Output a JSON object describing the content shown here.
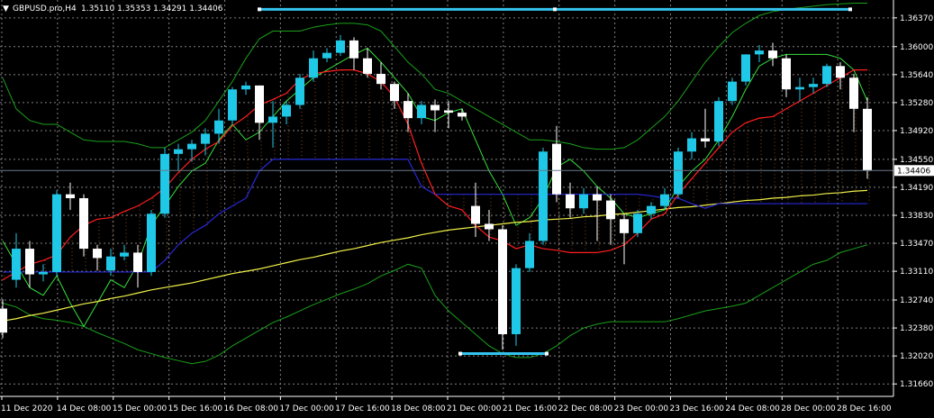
{
  "header": {
    "symbol": "GBPUSD.pro,H4",
    "ohlc": "1.35110 1.35353 1.34291 1.34406"
  },
  "colors": {
    "background": "#000000",
    "grid": "#808080",
    "bull": "#1fc8e6",
    "bear": "#ffffff",
    "fast_ma": "#ff1e1e",
    "slow_ma": "#2828d8",
    "long_ma": "#f0f04a",
    "envelope": "#1aa01a",
    "fast_band": "#36e03a",
    "cloud": "#f08c3c",
    "hline": "#33c2ee"
  },
  "chart_data": {
    "type": "candlestick",
    "y_axis": {
      "ylim": [
        1.315,
        1.366
      ],
      "ticks": [
        "1.36370",
        "1.36000",
        "1.35640",
        "1.35280",
        "1.34920",
        "1.34550",
        "1.34190",
        "1.33830",
        "1.33470",
        "1.33110",
        "1.32740",
        "1.32380",
        "1.32020",
        "1.31660"
      ],
      "current_price": "1.34406"
    },
    "x_axis": {
      "ticks": [
        "11 Dec 2020",
        "14 Dec 08:00",
        "15 Dec 00:00",
        "15 Dec 16:00",
        "16 Dec 08:00",
        "17 Dec 00:00",
        "17 Dec 16:00",
        "18 Dec 08:00",
        "21 Dec 00:00",
        "21 Dec 16:00",
        "22 Dec 08:00",
        "23 Dec 00:00",
        "23 Dec 16:00",
        "24 Dec 08:00",
        "28 Dec 00:00",
        "28 Dec 16:00"
      ]
    },
    "grid": true,
    "candles": [
      {
        "o": 1.3263,
        "h": 1.3275,
        "l": 1.3225,
        "c": 1.3232
      },
      {
        "o": 1.33,
        "h": 1.336,
        "l": 1.329,
        "c": 1.334
      },
      {
        "o": 1.334,
        "h": 1.335,
        "l": 1.329,
        "c": 1.3307
      },
      {
        "o": 1.3307,
        "h": 1.332,
        "l": 1.3298,
        "c": 1.331
      },
      {
        "o": 1.331,
        "h": 1.3415,
        "l": 1.3305,
        "c": 1.341
      },
      {
        "o": 1.341,
        "h": 1.3425,
        "l": 1.339,
        "c": 1.3405
      },
      {
        "o": 1.3405,
        "h": 1.341,
        "l": 1.333,
        "c": 1.334
      },
      {
        "o": 1.334,
        "h": 1.3345,
        "l": 1.3312,
        "c": 1.3328
      },
      {
        "o": 1.3312,
        "h": 1.334,
        "l": 1.3305,
        "c": 1.333
      },
      {
        "o": 1.333,
        "h": 1.3345,
        "l": 1.3325,
        "c": 1.3335
      },
      {
        "o": 1.3335,
        "h": 1.3345,
        "l": 1.329,
        "c": 1.331
      },
      {
        "o": 1.331,
        "h": 1.339,
        "l": 1.3305,
        "c": 1.3385
      },
      {
        "o": 1.3385,
        "h": 1.347,
        "l": 1.338,
        "c": 1.3462
      },
      {
        "o": 1.3462,
        "h": 1.3475,
        "l": 1.344,
        "c": 1.3468
      },
      {
        "o": 1.3468,
        "h": 1.348,
        "l": 1.3452,
        "c": 1.3475
      },
      {
        "o": 1.3475,
        "h": 1.3495,
        "l": 1.346,
        "c": 1.3488
      },
      {
        "o": 1.3488,
        "h": 1.352,
        "l": 1.3475,
        "c": 1.3505
      },
      {
        "o": 1.3505,
        "h": 1.3548,
        "l": 1.35,
        "c": 1.3545
      },
      {
        "o": 1.3545,
        "h": 1.3555,
        "l": 1.3538,
        "c": 1.355
      },
      {
        "o": 1.355,
        "h": 1.355,
        "l": 1.348,
        "c": 1.3502
      },
      {
        "o": 1.3502,
        "h": 1.353,
        "l": 1.347,
        "c": 1.351
      },
      {
        "o": 1.351,
        "h": 1.353,
        "l": 1.35,
        "c": 1.3525
      },
      {
        "o": 1.3525,
        "h": 1.3565,
        "l": 1.352,
        "c": 1.356
      },
      {
        "o": 1.356,
        "h": 1.3595,
        "l": 1.3555,
        "c": 1.3585
      },
      {
        "o": 1.3585,
        "h": 1.3598,
        "l": 1.358,
        "c": 1.3592
      },
      {
        "o": 1.3592,
        "h": 1.3615,
        "l": 1.3588,
        "c": 1.3608
      },
      {
        "o": 1.3608,
        "h": 1.3612,
        "l": 1.357,
        "c": 1.3585
      },
      {
        "o": 1.3585,
        "h": 1.3598,
        "l": 1.356,
        "c": 1.3565
      },
      {
        "o": 1.3565,
        "h": 1.358,
        "l": 1.3545,
        "c": 1.3552
      },
      {
        "o": 1.3552,
        "h": 1.3555,
        "l": 1.352,
        "c": 1.353
      },
      {
        "o": 1.353,
        "h": 1.354,
        "l": 1.349,
        "c": 1.3508
      },
      {
        "o": 1.3508,
        "h": 1.353,
        "l": 1.35,
        "c": 1.3525
      },
      {
        "o": 1.3525,
        "h": 1.3532,
        "l": 1.349,
        "c": 1.3518
      },
      {
        "o": 1.3518,
        "h": 1.353,
        "l": 1.3495,
        "c": 1.3515
      },
      {
        "o": 1.3515,
        "h": 1.352,
        "l": 1.3505,
        "c": 1.351
      },
      {
        "o": 1.3395,
        "h": 1.3425,
        "l": 1.3355,
        "c": 1.3372
      },
      {
        "o": 1.3372,
        "h": 1.339,
        "l": 1.335,
        "c": 1.3365
      },
      {
        "o": 1.3365,
        "h": 1.337,
        "l": 1.321,
        "c": 1.323
      },
      {
        "o": 1.323,
        "h": 1.332,
        "l": 1.3215,
        "c": 1.3315
      },
      {
        "o": 1.3315,
        "h": 1.336,
        "l": 1.331,
        "c": 1.335
      },
      {
        "o": 1.335,
        "h": 1.347,
        "l": 1.3345,
        "c": 1.3465
      },
      {
        "o": 1.3475,
        "h": 1.3498,
        "l": 1.34,
        "c": 1.341
      },
      {
        "o": 1.341,
        "h": 1.3425,
        "l": 1.338,
        "c": 1.3392
      },
      {
        "o": 1.3392,
        "h": 1.3418,
        "l": 1.3385,
        "c": 1.341
      },
      {
        "o": 1.341,
        "h": 1.342,
        "l": 1.335,
        "c": 1.3402
      },
      {
        "o": 1.3402,
        "h": 1.341,
        "l": 1.3345,
        "c": 1.3378
      },
      {
        "o": 1.3378,
        "h": 1.3385,
        "l": 1.332,
        "c": 1.336
      },
      {
        "o": 1.336,
        "h": 1.339,
        "l": 1.3355,
        "c": 1.3385
      },
      {
        "o": 1.3385,
        "h": 1.34,
        "l": 1.3378,
        "c": 1.3395
      },
      {
        "o": 1.3395,
        "h": 1.3418,
        "l": 1.339,
        "c": 1.341
      },
      {
        "o": 1.341,
        "h": 1.347,
        "l": 1.3405,
        "c": 1.3465
      },
      {
        "o": 1.3465,
        "h": 1.349,
        "l": 1.3455,
        "c": 1.3482
      },
      {
        "o": 1.3482,
        "h": 1.352,
        "l": 1.347,
        "c": 1.3478
      },
      {
        "o": 1.3478,
        "h": 1.3535,
        "l": 1.3472,
        "c": 1.353
      },
      {
        "o": 1.353,
        "h": 1.356,
        "l": 1.3525,
        "c": 1.3555
      },
      {
        "o": 1.3555,
        "h": 1.359,
        "l": 1.355,
        "c": 1.359
      },
      {
        "o": 1.359,
        "h": 1.3602,
        "l": 1.358,
        "c": 1.3595
      },
      {
        "o": 1.3595,
        "h": 1.3605,
        "l": 1.3575,
        "c": 1.3585
      },
      {
        "o": 1.3585,
        "h": 1.359,
        "l": 1.3535,
        "c": 1.3545
      },
      {
        "o": 1.3545,
        "h": 1.356,
        "l": 1.353,
        "c": 1.3548
      },
      {
        "o": 1.3548,
        "h": 1.356,
        "l": 1.354,
        "c": 1.3552
      },
      {
        "o": 1.3552,
        "h": 1.3578,
        "l": 1.3548,
        "c": 1.3575
      },
      {
        "o": 1.3575,
        "h": 1.358,
        "l": 1.3545,
        "c": 1.356
      },
      {
        "o": 1.356,
        "h": 1.3565,
        "l": 1.349,
        "c": 1.352
      },
      {
        "o": 1.352,
        "h": 1.3535,
        "l": 1.343,
        "c": 1.3441
      }
    ],
    "lines": {
      "fast_ma": [
        1.33,
        1.331,
        1.332,
        1.3325,
        1.3332,
        1.3355,
        1.337,
        1.3378,
        1.338,
        1.3388,
        1.3395,
        1.3405,
        1.3418,
        1.3438,
        1.3455,
        1.3468,
        1.3478,
        1.3498,
        1.351,
        1.3525,
        1.3532,
        1.354,
        1.3558,
        1.3565,
        1.3568,
        1.357,
        1.357,
        1.3565,
        1.3555,
        1.3535,
        1.35,
        1.345,
        1.341,
        1.3395,
        1.339,
        1.337,
        1.3355,
        1.335,
        1.334,
        1.3345,
        1.334,
        1.3338,
        1.3335,
        1.3335,
        1.3335,
        1.3338,
        1.3345,
        1.336,
        1.3378,
        1.3385,
        1.341,
        1.343,
        1.345,
        1.347,
        1.349,
        1.3502,
        1.3508,
        1.351,
        1.352,
        1.353,
        1.354,
        1.355,
        1.356,
        1.357,
        1.357
      ],
      "slow_ma": [
        1.331,
        1.331,
        1.331,
        1.331,
        1.331,
        1.331,
        1.331,
        1.331,
        1.331,
        1.331,
        1.331,
        1.331,
        1.3325,
        1.3345,
        1.336,
        1.337,
        1.3385,
        1.3395,
        1.3405,
        1.344,
        1.3455,
        1.3455,
        1.3455,
        1.3455,
        1.3455,
        1.3455,
        1.3455,
        1.3455,
        1.3455,
        1.3455,
        1.3455,
        1.342,
        1.341,
        1.341,
        1.341,
        1.341,
        1.341,
        1.341,
        1.341,
        1.341,
        1.341,
        1.341,
        1.341,
        1.341,
        1.341,
        1.341,
        1.341,
        1.341,
        1.3408,
        1.3405,
        1.3405,
        1.3398,
        1.3392,
        1.3398,
        1.3398,
        1.3398,
        1.3398,
        1.3398,
        1.3398,
        1.3398,
        1.3398,
        1.3398,
        1.3398,
        1.3398,
        1.3398
      ],
      "long_ma": [
        1.3247,
        1.325,
        1.3254,
        1.3257,
        1.3261,
        1.3265,
        1.3269,
        1.3272,
        1.3276,
        1.3279,
        1.3283,
        1.3287,
        1.329,
        1.3293,
        1.3296,
        1.33,
        1.3304,
        1.3308,
        1.3311,
        1.3314,
        1.3318,
        1.3322,
        1.3326,
        1.3329,
        1.3333,
        1.3337,
        1.334,
        1.3344,
        1.3348,
        1.3351,
        1.3354,
        1.3358,
        1.3361,
        1.3364,
        1.3366,
        1.3368,
        1.337,
        1.3372,
        1.3374,
        1.3375,
        1.3377,
        1.3378,
        1.3379,
        1.3381,
        1.3382,
        1.3384,
        1.3385,
        1.3387,
        1.3389,
        1.3391,
        1.3393,
        1.3394,
        1.3396,
        1.3398,
        1.34,
        1.3402,
        1.3403,
        1.3405,
        1.3406,
        1.3408,
        1.3409,
        1.3411,
        1.3412,
        1.3414,
        1.3415
      ],
      "envelope_upper": [
        1.356,
        1.352,
        1.3505,
        1.35,
        1.35,
        1.349,
        1.348,
        1.3478,
        1.3478,
        1.3478,
        1.3475,
        1.347,
        1.347,
        1.348,
        1.349,
        1.3505,
        1.353,
        1.3555,
        1.3585,
        1.361,
        1.362,
        1.362,
        1.362,
        1.3625,
        1.3628,
        1.363,
        1.363,
        1.3628,
        1.362,
        1.36,
        1.358,
        1.3565,
        1.3545,
        1.354,
        1.353,
        1.352,
        1.351,
        1.35,
        1.349,
        1.348,
        1.348,
        1.3478,
        1.3475,
        1.347,
        1.3468,
        1.3468,
        1.347,
        1.348,
        1.3495,
        1.351,
        1.353,
        1.3555,
        1.358,
        1.36,
        1.3618,
        1.363,
        1.364,
        1.3645,
        1.3648,
        1.365,
        1.3652,
        1.3654,
        1.3655,
        1.3656,
        1.3656
      ],
      "envelope_lower": [
        1.327,
        1.3265,
        1.3255,
        1.325,
        1.3248,
        1.3245,
        1.324,
        1.3232,
        1.3225,
        1.3218,
        1.321,
        1.3205,
        1.32,
        1.3196,
        1.3192,
        1.3195,
        1.3203,
        1.3215,
        1.3225,
        1.3235,
        1.3245,
        1.3252,
        1.326,
        1.3268,
        1.3275,
        1.3282,
        1.3288,
        1.3295,
        1.3305,
        1.3312,
        1.332,
        1.3315,
        1.328,
        1.326,
        1.3245,
        1.323,
        1.3215,
        1.3205,
        1.32,
        1.32,
        1.3205,
        1.3215,
        1.3228,
        1.3238,
        1.3243,
        1.3246,
        1.3246,
        1.3246,
        1.3246,
        1.3246,
        1.325,
        1.3255,
        1.326,
        1.3263,
        1.3266,
        1.327,
        1.328,
        1.329,
        1.33,
        1.331,
        1.332,
        1.3325,
        1.3335,
        1.334,
        1.3345
      ],
      "fast_band": [
        1.335,
        1.332,
        1.329,
        1.328,
        1.3305,
        1.327,
        1.324,
        1.327,
        1.33,
        1.329,
        1.332,
        1.337,
        1.3395,
        1.342,
        1.344,
        1.345,
        1.348,
        1.35,
        1.348,
        1.349,
        1.351,
        1.353,
        1.3545,
        1.356,
        1.357,
        1.358,
        1.359,
        1.3598,
        1.358,
        1.356,
        1.354,
        1.351,
        1.3505,
        1.3515,
        1.352,
        1.348,
        1.344,
        1.341,
        1.337,
        1.338,
        1.3405,
        1.3445,
        1.3455,
        1.344,
        1.342,
        1.3405,
        1.3385,
        1.338,
        1.3385,
        1.339,
        1.342,
        1.344,
        1.3455,
        1.348,
        1.351,
        1.3545,
        1.3575,
        1.3585,
        1.359,
        1.359,
        1.359,
        1.359,
        1.3585,
        1.357,
        1.353
      ]
    },
    "annotations": {
      "resistance_level": 1.3648,
      "support_level": 1.3205
    }
  }
}
